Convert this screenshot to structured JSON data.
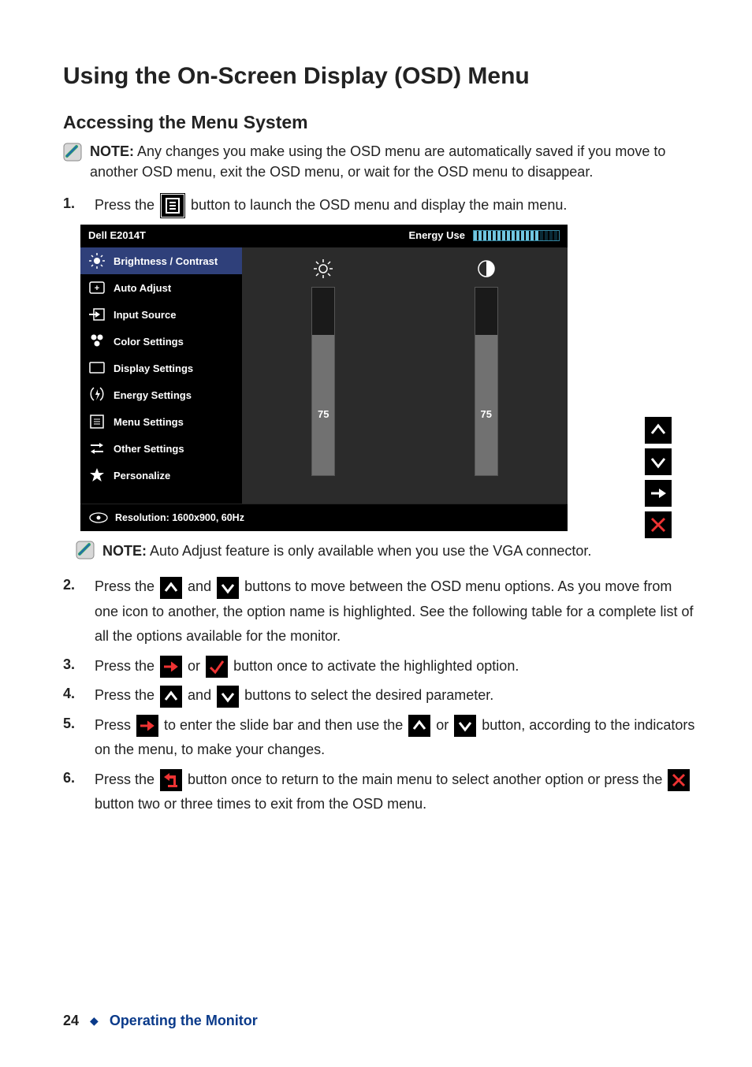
{
  "page": {
    "title": "Using the On-Screen Display (OSD) Menu",
    "subtitle": "Accessing the Menu System",
    "number": "24",
    "section": "Operating the Monitor"
  },
  "notes": {
    "top": {
      "label": "NOTE:",
      "text": " Any changes you make using the OSD menu are automatically saved if you move to another OSD menu, exit the OSD menu, or wait for the OSD menu to disappear."
    },
    "auto_adjust": {
      "label": "NOTE:",
      "text": " Auto Adjust feature is only available when you use the VGA connector."
    }
  },
  "steps": {
    "s1": {
      "n": "1.",
      "a": "Press the ",
      "b": " button to launch the OSD menu and display the main menu."
    },
    "s2": {
      "n": "2.",
      "a": "Press the ",
      "b": " and ",
      "c": " buttons to move between the OSD menu options. As you move from one icon to another, the option name is highlighted. See the following table for a complete list of all the options available for the monitor."
    },
    "s3": {
      "n": "3.",
      "a": "Press the ",
      "b": " or ",
      "c": " button once to activate the highlighted option."
    },
    "s4": {
      "n": "4.",
      "a": "Press the ",
      "b": " and ",
      "c": " buttons to select the desired parameter."
    },
    "s5": {
      "n": "5.",
      "a": "Press ",
      "b": " to enter the slide bar and then use the ",
      "c": " or ",
      "d": " button, according to the indicators on the menu, to make your changes."
    },
    "s6": {
      "n": "6.",
      "a": "Press the ",
      "b": " button once to return to the main menu to select another option or press the ",
      "c": " button two or three times to exit from the OSD menu."
    }
  },
  "osd": {
    "model": "Dell E2014T",
    "energy_label": "Energy Use",
    "energy_fill_segments": 14,
    "energy_total_segments": 18,
    "menu": [
      "Brightness / Contrast",
      "Auto Adjust",
      "Input Source",
      "Color Settings",
      "Display Settings",
      "Energy Settings",
      "Menu Settings",
      "Other Settings",
      "Personalize"
    ],
    "brightness_value": "75",
    "contrast_value": "75",
    "resolution": "Resolution: 1600x900, 60Hz"
  }
}
